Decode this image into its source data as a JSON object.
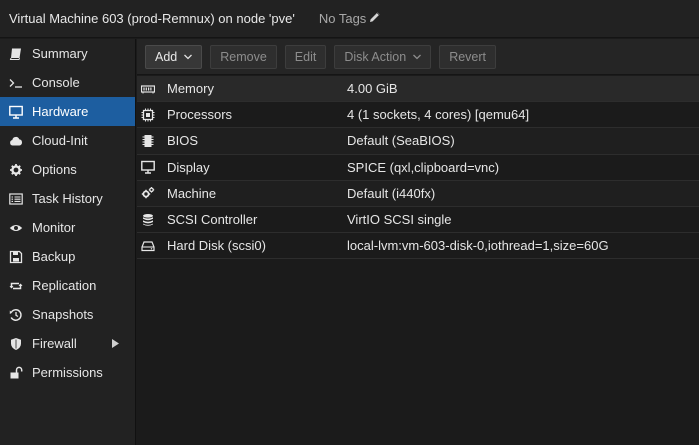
{
  "header": {
    "title": "Virtual Machine 603 (prod-Remnux) on node 'pve'",
    "tags_label": "No Tags"
  },
  "sidebar": {
    "items": [
      {
        "label": "Summary",
        "icon": "book-icon"
      },
      {
        "label": "Console",
        "icon": "terminal-icon"
      },
      {
        "label": "Hardware",
        "icon": "monitor-icon",
        "active": true
      },
      {
        "label": "Cloud-Init",
        "icon": "cloud-icon"
      },
      {
        "label": "Options",
        "icon": "gear-icon"
      },
      {
        "label": "Task History",
        "icon": "list-icon"
      },
      {
        "label": "Monitor",
        "icon": "eye-icon"
      },
      {
        "label": "Backup",
        "icon": "floppy-icon"
      },
      {
        "label": "Replication",
        "icon": "retweet-icon"
      },
      {
        "label": "Snapshots",
        "icon": "history-icon"
      },
      {
        "label": "Firewall",
        "icon": "shield-icon"
      },
      {
        "label": "Permissions",
        "icon": "unlock-icon"
      }
    ]
  },
  "toolbar": {
    "add_label": "Add",
    "remove_label": "Remove",
    "edit_label": "Edit",
    "disk_action_label": "Disk Action",
    "revert_label": "Revert"
  },
  "hardware": {
    "rows": [
      {
        "key": "Memory",
        "value": "4.00 GiB",
        "icon": "memory-icon"
      },
      {
        "key": "Processors",
        "value": "4 (1 sockets, 4 cores) [qemu64]",
        "icon": "cpu-icon"
      },
      {
        "key": "BIOS",
        "value": "Default (SeaBIOS)",
        "icon": "microchip-icon"
      },
      {
        "key": "Display",
        "value": "SPICE (qxl,clipboard=vnc)",
        "icon": "desktop-icon"
      },
      {
        "key": "Machine",
        "value": "Default (i440fx)",
        "icon": "cogs-icon"
      },
      {
        "key": "SCSI Controller",
        "value": "VirtIO SCSI single",
        "icon": "database-icon"
      },
      {
        "key": "Hard Disk (scsi0)",
        "value": "local-lvm:vm-603-disk-0,iothread=1,size=60G",
        "icon": "hdd-icon"
      }
    ]
  },
  "colors": {
    "accent": "#1d5ea0",
    "background": "#1b1b1b",
    "panel": "#222222"
  }
}
